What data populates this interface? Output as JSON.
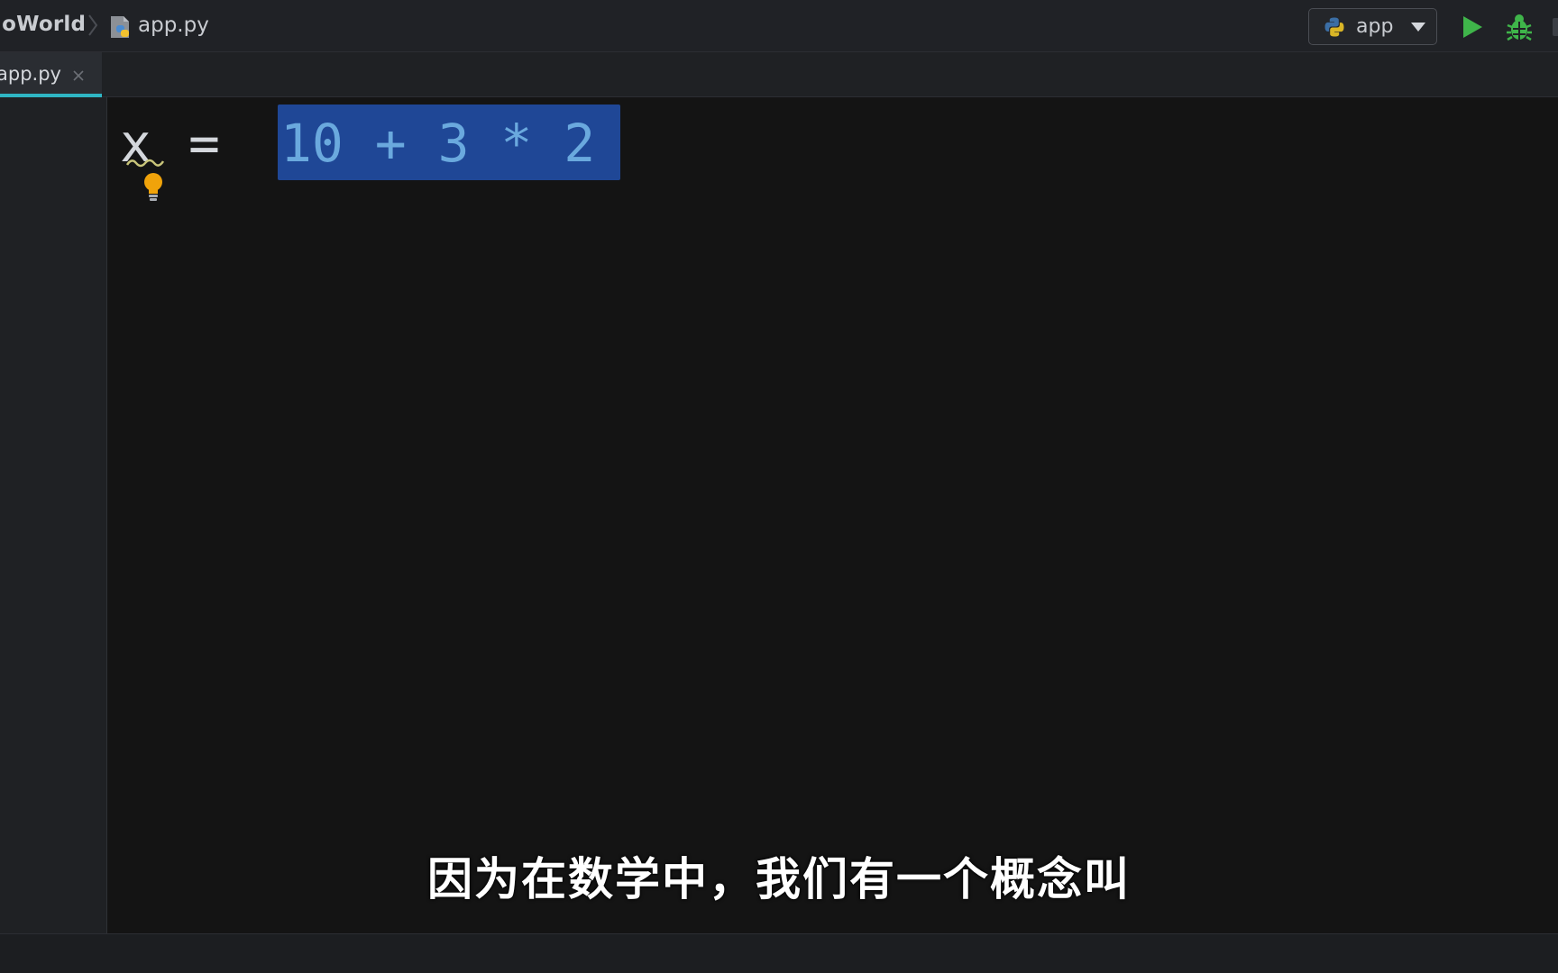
{
  "navbar": {
    "project_crumb": "loWorld",
    "file_crumb": "app.py",
    "run_config_label": "app",
    "icons": {
      "separator": "chevron-right-icon",
      "file": "python-file-icon",
      "run_config": "python-icon",
      "dropdown": "chevron-down-icon",
      "run": "run-icon",
      "debug": "debug-icon"
    }
  },
  "tabs": [
    {
      "label": "app.py",
      "active": true
    }
  ],
  "editor": {
    "line": {
      "variable": "x",
      "operator": "=",
      "selected_expression": "10 + 3 * 2"
    },
    "intention_icon": "lightbulb-icon"
  },
  "caption": "因为在数学中，我们有一个概念叫",
  "colors": {
    "accent_tab": "#2fb6c4",
    "selection": "#1f4796",
    "number": "#6aa9de",
    "run_green": "#3fb54a",
    "bulb": "#f0a30a",
    "editor_bg": "#141414"
  }
}
